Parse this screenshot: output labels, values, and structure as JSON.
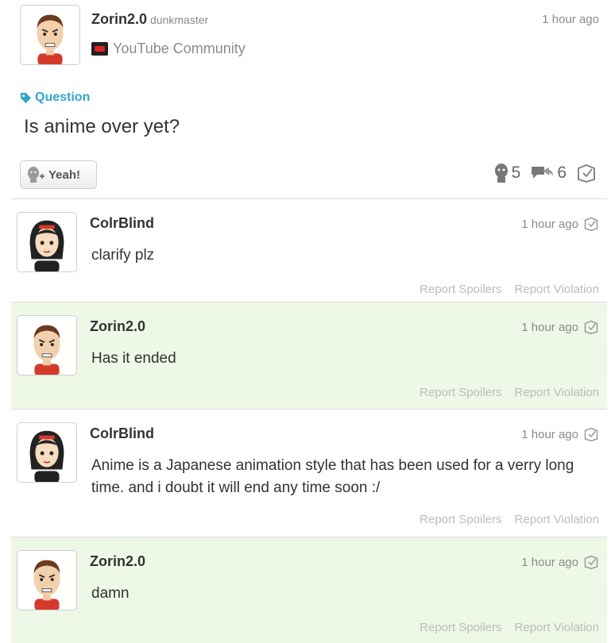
{
  "post": {
    "username": "Zorin2.0",
    "handle": "dunkmaster",
    "time": "1 hour ago",
    "community": "YouTube Community",
    "tag": "Question",
    "body": "Is anime over yet?",
    "yeah_label": "Yeah!",
    "yeah_count": "5",
    "reply_count": "6"
  },
  "comments": [
    {
      "username": "ColrBlind",
      "time": "1 hour ago",
      "text": "clarify plz",
      "report_spoilers": "Report Spoilers",
      "report_violation": "Report Violation"
    },
    {
      "username": "Zorin2.0",
      "time": "1 hour ago",
      "text": "Has it ended",
      "report_spoilers": "Report Spoilers",
      "report_violation": "Report Violation"
    },
    {
      "username": "ColrBlind",
      "time": "1 hour ago",
      "text": "Anime is a Japanese animation style that has been used for a verry long time. and i doubt it will end any time soon :/",
      "report_spoilers": "Report Spoilers",
      "report_violation": "Report Violation"
    },
    {
      "username": "Zorin2.0",
      "time": "1 hour ago",
      "text": "damn",
      "report_spoilers": "Report Spoilers",
      "report_violation": "Report Violation"
    }
  ],
  "colors": {
    "accent": "#33a5c8",
    "highlight_bg": "#eef8e6",
    "muted_text": "#8a8a8a"
  },
  "icons": [
    "question-tag-icon",
    "yeah-add-icon",
    "yeah-count-icon",
    "reply-count-icon",
    "spoiler-icon",
    "youtube-icon"
  ]
}
